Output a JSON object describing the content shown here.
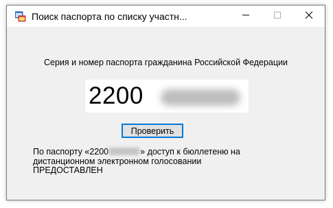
{
  "window": {
    "title": "Поиск паспорта по списку участн...",
    "icon": "app-form-icon",
    "controls": [
      "minimize-icon",
      "maximize-icon",
      "close-icon"
    ]
  },
  "form": {
    "prompt_label": "Серия и номер паспорта гражданина Российской Федерации",
    "passport_series": "2200",
    "check_button_label": "Проверить"
  },
  "result": {
    "part1": "По паспорту «2200",
    "part2": "» доступ к бюллетеню на",
    "line2": "дистанционном электронном голосовании",
    "line3": "ПРЕДОСТАВЛЕН"
  },
  "colors": {
    "window_bg": "#f0f0f0",
    "button_border_focus": "#0078d7"
  }
}
